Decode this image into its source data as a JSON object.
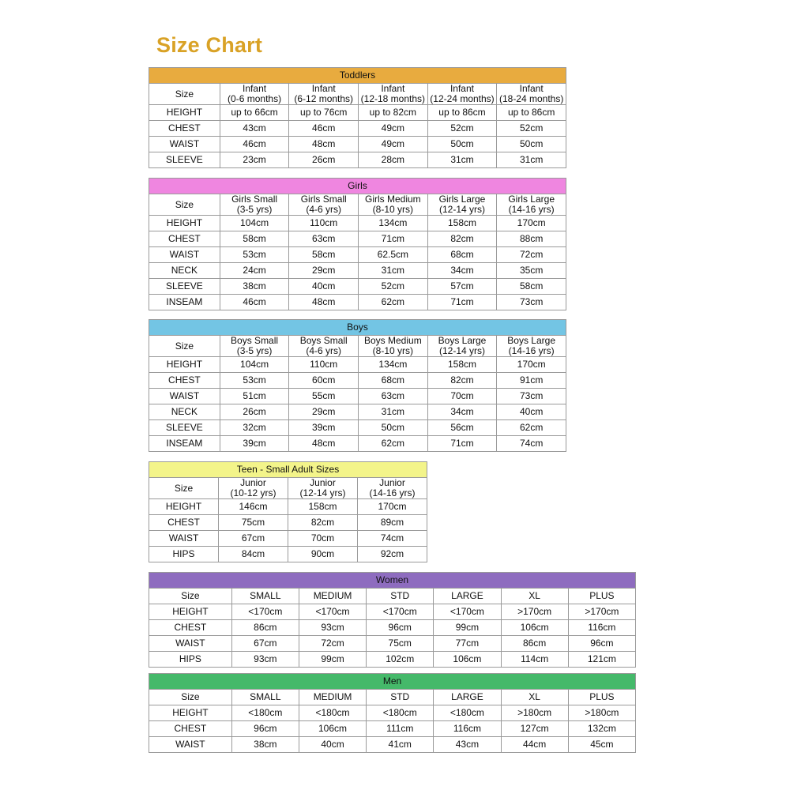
{
  "page": {
    "title": "Size Chart",
    "background": "#ffffff",
    "title_color": "#d9a226"
  },
  "tables": [
    {
      "id": "toddlers",
      "title": "Toddlers",
      "band_color": "#e8ab3f",
      "size_label": "Size",
      "columns": [
        {
          "line1": "Infant",
          "line2": "(0-6 months)"
        },
        {
          "line1": "Infant",
          "line2": "(6-12 months)"
        },
        {
          "line1": "Infant",
          "line2": "(12-18 months)"
        },
        {
          "line1": "Infant",
          "line2": "(12-24 months)"
        },
        {
          "line1": "Infant",
          "line2": "(18-24 months)"
        }
      ],
      "rows": [
        {
          "label": "HEIGHT",
          "values": [
            "up to 66cm",
            "up to 76cm",
            "up to 82cm",
            "up to 86cm",
            "up to 86cm"
          ]
        },
        {
          "label": "CHEST",
          "values": [
            "43cm",
            "46cm",
            "49cm",
            "52cm",
            "52cm"
          ]
        },
        {
          "label": "WAIST",
          "values": [
            "46cm",
            "48cm",
            "49cm",
            "50cm",
            "50cm"
          ]
        },
        {
          "label": "SLEEVE",
          "values": [
            "23cm",
            "26cm",
            "28cm",
            "31cm",
            "31cm"
          ]
        }
      ]
    },
    {
      "id": "girls",
      "title": "Girls",
      "band_color": "#ef86e0",
      "size_label": "Size",
      "columns": [
        {
          "line1": "Girls Small",
          "line2": "(3-5 yrs)"
        },
        {
          "line1": "Girls Small",
          "line2": "(4-6 yrs)"
        },
        {
          "line1": "Girls Medium",
          "line2": "(8-10 yrs)"
        },
        {
          "line1": "Girls Large",
          "line2": "(12-14 yrs)"
        },
        {
          "line1": "Girls Large",
          "line2": "(14-16 yrs)"
        }
      ],
      "rows": [
        {
          "label": "HEIGHT",
          "values": [
            "104cm",
            "110cm",
            "134cm",
            "158cm",
            "170cm"
          ]
        },
        {
          "label": "CHEST",
          "values": [
            "58cm",
            "63cm",
            "71cm",
            "82cm",
            "88cm"
          ]
        },
        {
          "label": "WAIST",
          "values": [
            "53cm",
            "58cm",
            "62.5cm",
            "68cm",
            "72cm"
          ]
        },
        {
          "label": "NECK",
          "values": [
            "24cm",
            "29cm",
            "31cm",
            "34cm",
            "35cm"
          ]
        },
        {
          "label": "SLEEVE",
          "values": [
            "38cm",
            "40cm",
            "52cm",
            "57cm",
            "58cm"
          ]
        },
        {
          "label": "INSEAM",
          "values": [
            "46cm",
            "48cm",
            "62cm",
            "71cm",
            "73cm"
          ]
        }
      ]
    },
    {
      "id": "boys",
      "title": "Boys",
      "band_color": "#73c5e4",
      "size_label": "Size",
      "columns": [
        {
          "line1": "Boys Small",
          "line2": "(3-5 yrs)"
        },
        {
          "line1": "Boys Small",
          "line2": "(4-6 yrs)"
        },
        {
          "line1": "Boys Medium",
          "line2": "(8-10 yrs)"
        },
        {
          "line1": "Boys Large",
          "line2": "(12-14 yrs)"
        },
        {
          "line1": "Boys Large",
          "line2": "(14-16 yrs)"
        }
      ],
      "rows": [
        {
          "label": "HEIGHT",
          "values": [
            "104cm",
            "110cm",
            "134cm",
            "158cm",
            "170cm"
          ]
        },
        {
          "label": "CHEST",
          "values": [
            "53cm",
            "60cm",
            "68cm",
            "82cm",
            "91cm"
          ]
        },
        {
          "label": "WAIST",
          "values": [
            "51cm",
            "55cm",
            "63cm",
            "70cm",
            "73cm"
          ]
        },
        {
          "label": "NECK",
          "values": [
            "26cm",
            "29cm",
            "31cm",
            "34cm",
            "40cm"
          ]
        },
        {
          "label": "SLEEVE",
          "values": [
            "32cm",
            "39cm",
            "50cm",
            "56cm",
            "62cm"
          ]
        },
        {
          "label": "INSEAM",
          "values": [
            "39cm",
            "48cm",
            "62cm",
            "71cm",
            "74cm"
          ]
        }
      ]
    },
    {
      "id": "teen",
      "title": "Teen - Small Adult Sizes",
      "band_color": "#f3f48a",
      "size_label": "Size",
      "columns": [
        {
          "line1": "Junior",
          "line2": "(10-12 yrs)"
        },
        {
          "line1": "Junior",
          "line2": "(12-14 yrs)"
        },
        {
          "line1": "Junior",
          "line2": "(14-16 yrs)"
        }
      ],
      "rows": [
        {
          "label": "HEIGHT",
          "values": [
            "146cm",
            "158cm",
            "170cm"
          ]
        },
        {
          "label": "CHEST",
          "values": [
            "75cm",
            "82cm",
            "89cm"
          ]
        },
        {
          "label": "WAIST",
          "values": [
            "67cm",
            "70cm",
            "74cm"
          ]
        },
        {
          "label": "HIPS",
          "values": [
            "84cm",
            "90cm",
            "92cm"
          ]
        }
      ]
    },
    {
      "id": "women",
      "title": "Women",
      "band_color": "#8e6cbf",
      "size_label": "Size",
      "columns": [
        {
          "line1": "SMALL",
          "line2": ""
        },
        {
          "line1": "MEDIUM",
          "line2": ""
        },
        {
          "line1": "STD",
          "line2": ""
        },
        {
          "line1": "LARGE",
          "line2": ""
        },
        {
          "line1": "XL",
          "line2": ""
        },
        {
          "line1": "PLUS",
          "line2": ""
        }
      ],
      "rows": [
        {
          "label": "HEIGHT",
          "values": [
            "<170cm",
            "<170cm",
            "<170cm",
            "<170cm",
            ">170cm",
            ">170cm"
          ]
        },
        {
          "label": "CHEST",
          "values": [
            "86cm",
            "93cm",
            "96cm",
            "99cm",
            "106cm",
            "116cm"
          ]
        },
        {
          "label": "WAIST",
          "values": [
            "67cm",
            "72cm",
            "75cm",
            "77cm",
            "86cm",
            "96cm"
          ]
        },
        {
          "label": "HIPS",
          "values": [
            "93cm",
            "99cm",
            "102cm",
            "106cm",
            "114cm",
            "121cm"
          ]
        }
      ]
    },
    {
      "id": "men",
      "title": "Men",
      "band_color": "#45b96a",
      "size_label": "Size",
      "columns": [
        {
          "line1": "SMALL",
          "line2": ""
        },
        {
          "line1": "MEDIUM",
          "line2": ""
        },
        {
          "line1": "STD",
          "line2": ""
        },
        {
          "line1": "LARGE",
          "line2": ""
        },
        {
          "line1": "XL",
          "line2": ""
        },
        {
          "line1": "PLUS",
          "line2": ""
        }
      ],
      "rows": [
        {
          "label": "HEIGHT",
          "values": [
            "<180cm",
            "<180cm",
            "<180cm",
            "<180cm",
            ">180cm",
            ">180cm"
          ]
        },
        {
          "label": "CHEST",
          "values": [
            "96cm",
            "106cm",
            "111cm",
            "116cm",
            "127cm",
            "132cm"
          ]
        },
        {
          "label": "WAIST",
          "values": [
            "38cm",
            "40cm",
            "41cm",
            "43cm",
            "44cm",
            "45cm"
          ]
        }
      ]
    }
  ]
}
